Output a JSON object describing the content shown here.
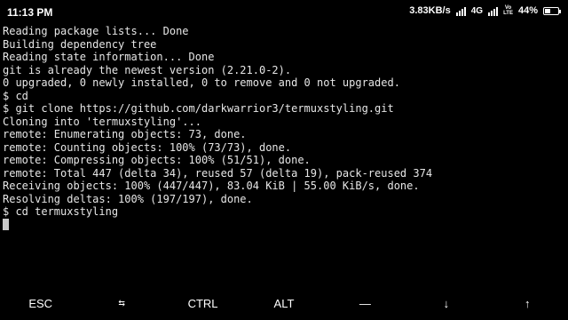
{
  "status_bar": {
    "time": "11:13 PM",
    "net_speed": "3.83KB/s",
    "network_type": "4G",
    "volte_top": "Vo",
    "volte_bottom": "LTE",
    "battery_percent": "44%",
    "battery_level": 0.44
  },
  "terminal": {
    "lines": [
      "Reading package lists... Done",
      "Building dependency tree",
      "Reading state information... Done",
      "git is already the newest version (2.21.0-2).",
      "0 upgraded, 0 newly installed, 0 to remove and 0 not upgraded.",
      "$ cd",
      "$ git clone https://github.com/darkwarrior3/termuxstyling.git",
      "Cloning into 'termuxstyling'...",
      "remote: Enumerating objects: 73, done.",
      "remote: Counting objects: 100% (73/73), done.",
      "remote: Compressing objects: 100% (51/51), done.",
      "remote: Total 447 (delta 34), reused 57 (delta 19), pack-reused 374",
      "Receiving objects: 100% (447/447), 83.04 KiB | 55.00 KiB/s, done.",
      "Resolving deltas: 100% (197/197), done.",
      "$ cd termuxstyling"
    ]
  },
  "extra_keys": {
    "esc": "ESC",
    "tab": "⇆",
    "ctrl": "CTRL",
    "alt": "ALT",
    "dash": "—",
    "down": "↓",
    "up": "↑"
  }
}
